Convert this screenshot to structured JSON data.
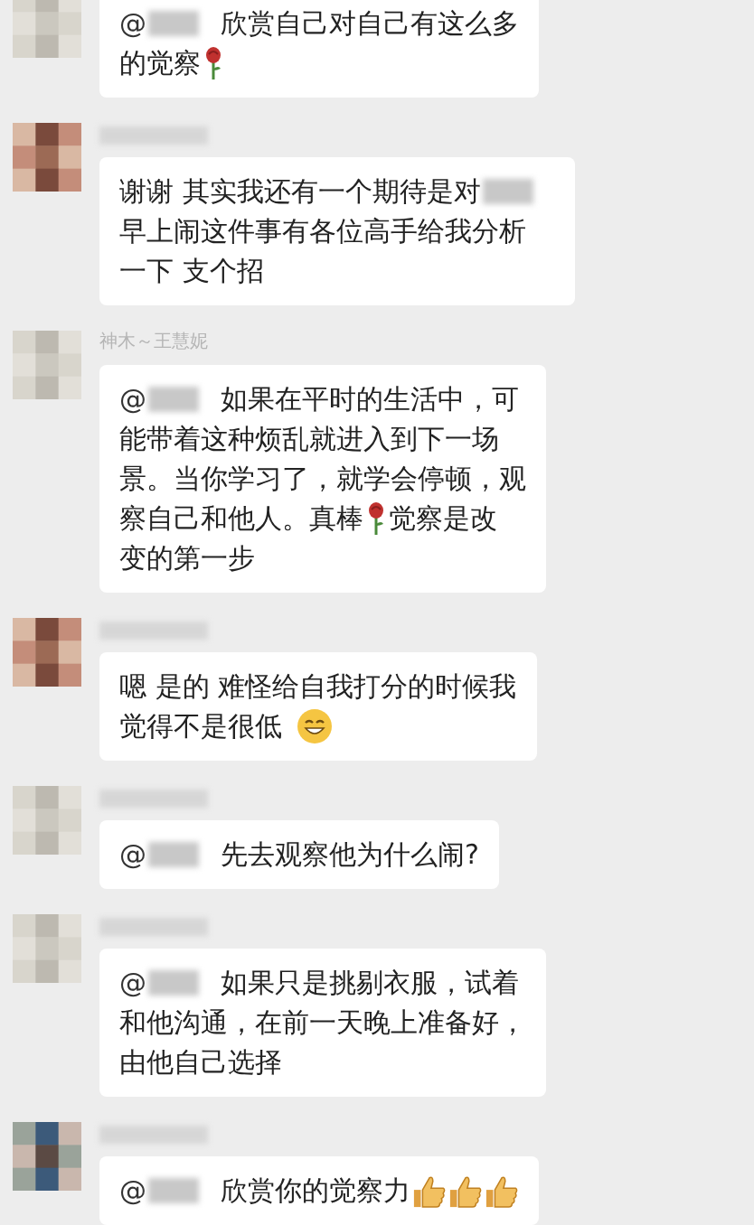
{
  "messages": [
    {
      "avatar": {
        "kind": "grey"
      },
      "lines": [
        [
          {
            "kind": "mention",
            "text": "@"
          },
          {
            "kind": "blur"
          },
          {
            "kind": "text",
            "text": "欣赏自己对自己有这么多"
          }
        ],
        [
          {
            "kind": "text",
            "text": "的觉察"
          },
          {
            "kind": "rose"
          }
        ]
      ]
    },
    {
      "avatar": {
        "kind": "warm"
      },
      "name_hidden": true,
      "lines": [
        [
          {
            "kind": "text",
            "text": "谢谢 其实我还有一个期待是对"
          },
          {
            "kind": "blur"
          }
        ],
        [
          {
            "kind": "text",
            "text": "早上闹这件事有各位高手给我分析"
          }
        ],
        [
          {
            "kind": "text",
            "text": "一下 支个招"
          }
        ]
      ]
    },
    {
      "avatar": {
        "kind": "grey"
      },
      "name": "神木～王慧妮",
      "name_hidden": false,
      "lines": [
        [
          {
            "kind": "mention",
            "text": "@"
          },
          {
            "kind": "blur"
          },
          {
            "kind": "text",
            "text": "如果在平时的生活中，可"
          }
        ],
        [
          {
            "kind": "text",
            "text": "能带着这种烦乱就进入到下一场"
          }
        ],
        [
          {
            "kind": "text",
            "text": "景。当你学习了，就学会停顿，观"
          }
        ],
        [
          {
            "kind": "text",
            "text": "察自己和他人。真棒"
          },
          {
            "kind": "rose"
          },
          {
            "kind": "text",
            "text": "觉察是改"
          }
        ],
        [
          {
            "kind": "text",
            "text": "变的第一步"
          }
        ]
      ]
    },
    {
      "avatar": {
        "kind": "warm"
      },
      "name_hidden": true,
      "lines": [
        [
          {
            "kind": "text",
            "text": "嗯 是的 难怪给自我打分的时候我"
          }
        ],
        [
          {
            "kind": "text",
            "text": "觉得不是很低"
          },
          {
            "kind": "smile"
          }
        ]
      ]
    },
    {
      "avatar": {
        "kind": "grey"
      },
      "name_hidden": true,
      "lines": [
        [
          {
            "kind": "mention",
            "text": "@"
          },
          {
            "kind": "blur"
          },
          {
            "kind": "text",
            "text": "先去观察他为什么闹?"
          }
        ]
      ]
    },
    {
      "avatar": {
        "kind": "grey"
      },
      "name_hidden": true,
      "lines": [
        [
          {
            "kind": "mention",
            "text": "@"
          },
          {
            "kind": "blur"
          },
          {
            "kind": "text",
            "text": "如果只是挑剔衣服，试着"
          }
        ],
        [
          {
            "kind": "text",
            "text": "和他沟通，在前一天晚上准备好，"
          }
        ],
        [
          {
            "kind": "text",
            "text": "由他自己选择"
          }
        ]
      ]
    },
    {
      "avatar": {
        "kind": "dark"
      },
      "name_hidden": true,
      "lines": [
        [
          {
            "kind": "mention",
            "text": "@"
          },
          {
            "kind": "blur"
          },
          {
            "kind": "text",
            "text": "欣赏你的觉察力"
          },
          {
            "kind": "thumbsup"
          },
          {
            "kind": "thumbsup"
          },
          {
            "kind": "thumbsup"
          }
        ]
      ]
    }
  ]
}
